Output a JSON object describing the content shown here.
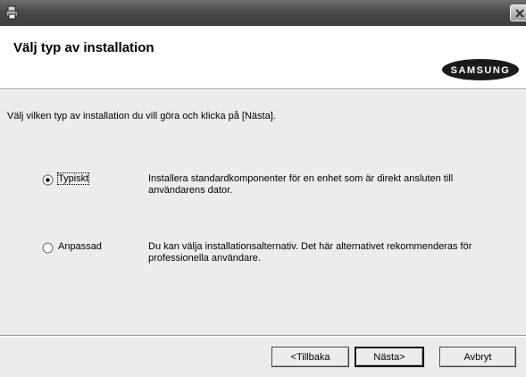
{
  "header": {
    "title": "Välj typ av installation",
    "logo_text": "SAMSUNG"
  },
  "instruction": "Välj vilken typ av installation du vill göra och klicka på [Nästa].",
  "options": [
    {
      "label": "Typiskt",
      "selected": true,
      "description": "Installera standardkomponenter för en enhet som är direkt ansluten till användarens dator."
    },
    {
      "label": "Anpassad",
      "selected": false,
      "description": "Du kan välja installationsalternativ. Det här alternativet rekommenderas för professionella användare."
    }
  ],
  "buttons": {
    "back": "<Tillbaka",
    "next": "Nästa>",
    "cancel": "Avbryt"
  },
  "icons": {
    "app": "printer-setup-icon",
    "close": "close-icon"
  },
  "colors": {
    "titlebar": "#4a4a4a",
    "dialog_background": "#ececec",
    "header_background": "#ffffff"
  }
}
